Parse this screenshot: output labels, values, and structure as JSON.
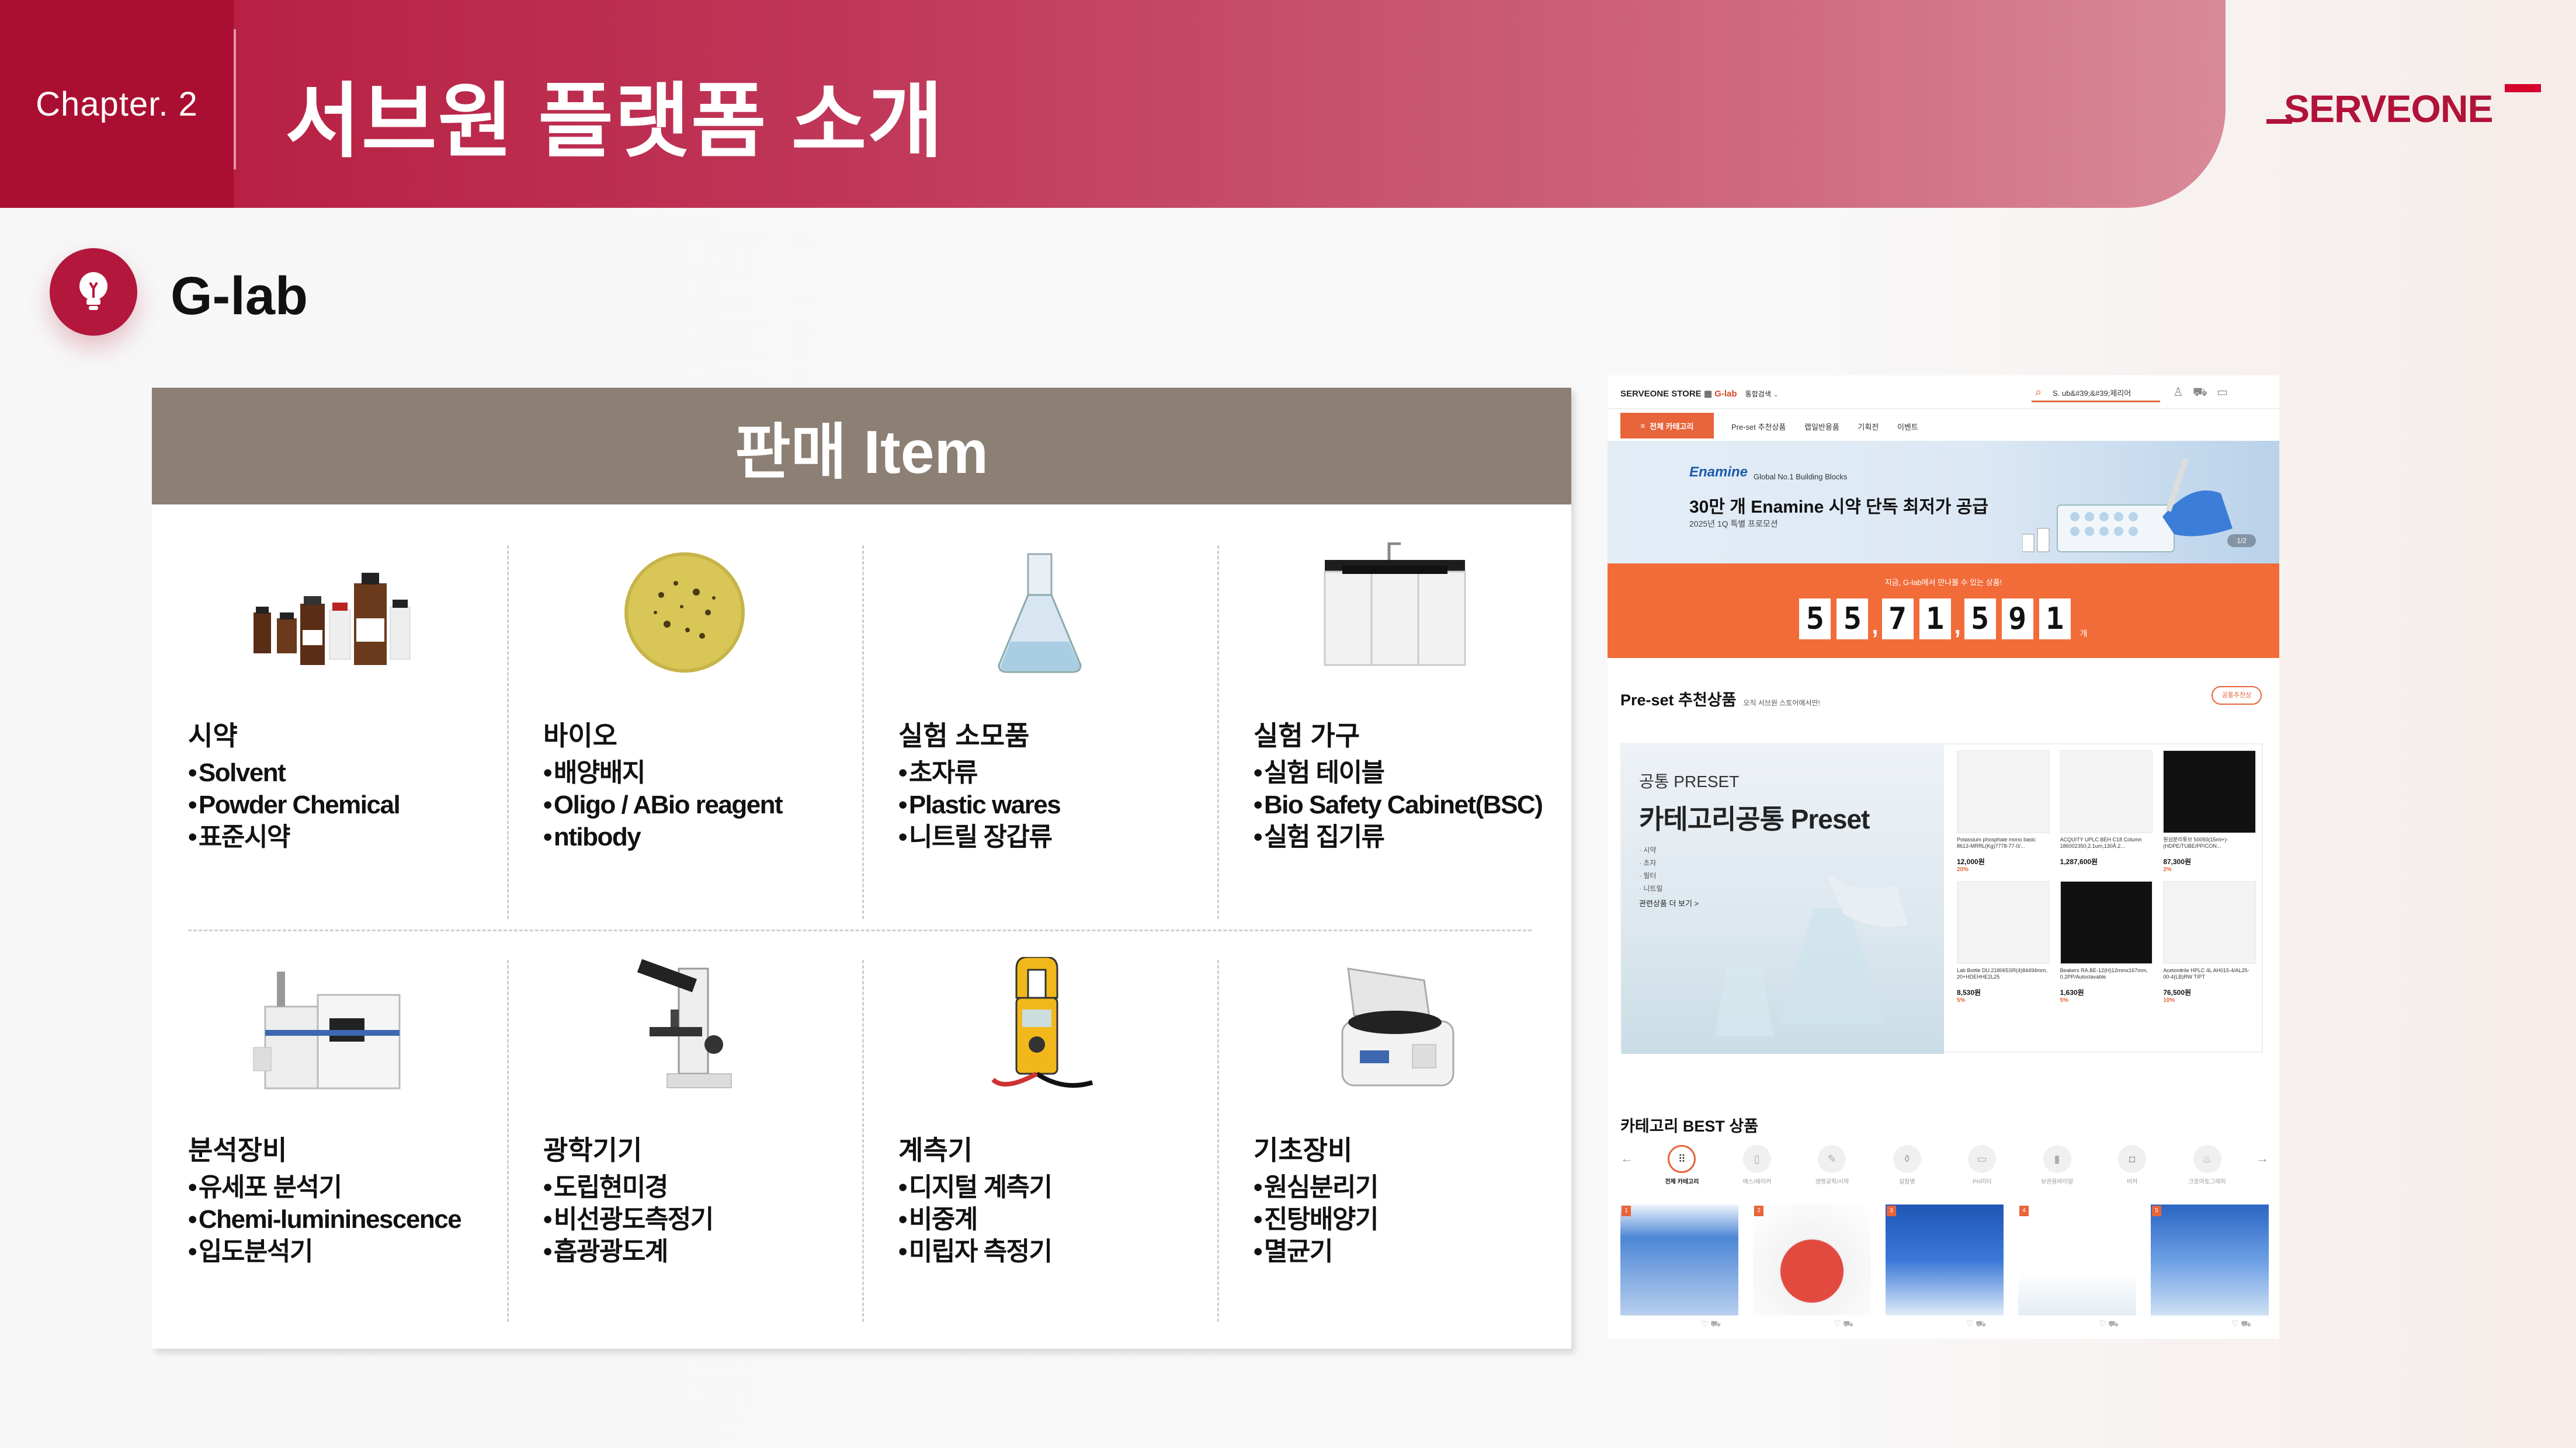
{
  "header": {
    "chapter": "Chapter. 2",
    "title": "서브원 플랫폼 소개",
    "logo": "SERVEONE"
  },
  "section": {
    "title": "G-lab"
  },
  "card": {
    "title": "판매 Item",
    "categories": [
      {
        "title": "시약",
        "items": [
          "Solvent",
          "Powder Chemical",
          "표준시약"
        ]
      },
      {
        "title": "바이오",
        "items": [
          "배양배지",
          "Oligo / ABio reagent",
          "ntibody"
        ]
      },
      {
        "title": "실험 소모품",
        "items": [
          "초자류",
          "Plastic wares",
          "니트릴 장갑류"
        ]
      },
      {
        "title": "실험 가구",
        "items": [
          "실험 테이블",
          "Bio Safety Cabinet(BSC)",
          "실험 집기류"
        ]
      },
      {
        "title": "분석장비",
        "items": [
          "유세포 분석기",
          "Chemi-lumininescence",
          "입도분석기"
        ]
      },
      {
        "title": "광학기기",
        "items": [
          "도립현미경",
          "비선광도측정기",
          "흡광광도계"
        ]
      },
      {
        "title": "계측기",
        "items": [
          "디지털 계측기",
          "비중계",
          "미립자 측정기"
        ]
      },
      {
        "title": "기초장비",
        "items": [
          "원심분리기",
          "진탕배양기",
          "멸균기"
        ]
      }
    ]
  },
  "shot": {
    "store": "SERVEONE STORE",
    "glab": "G-lab",
    "search": "통합검색",
    "search_query": "S. ub&#39;&#39;제리어",
    "all_category": "전체 카테고리",
    "menu": [
      "Pre-set 추천상품",
      "랩일반용품",
      "기획전",
      "이벤트"
    ],
    "hero": {
      "brand": "Enamine",
      "brand_sub": "Global No.1 Building Blocks",
      "title": "30만 개 Enamine 시약 단독 최저가 공급",
      "subtitle": "2025년 1Q 특별 프로모션",
      "page": "1/2"
    },
    "counter": {
      "caption": "지금, G-lab에서 만나볼 수 있는 상품!",
      "digits": [
        "5",
        "5",
        "7",
        "1",
        "5",
        "9",
        "1"
      ],
      "unit": "개"
    },
    "preset": {
      "heading": "Pre-set 추천상품",
      "heading_sub": "오직 서브원 스토어에서만!",
      "more": "공통추천상",
      "tag": "공통 PRESET",
      "name": "카테고리공통 Preset",
      "lines": [
        "· 시약",
        "· 초자",
        "· 필터",
        "· 니트릴"
      ],
      "link": "관련상품 더 보기 >",
      "products": [
        {
          "name": "Potassium phosphate mono basic 8613-MRRL(Kg)7778-77-0/...",
          "price": "12,000원",
          "disc": "20%"
        },
        {
          "name": "ACQUITY UPLC BEH C18 Column 186002350,2.1um,130Å,2...",
          "price": "1,287,600원",
          "disc": ""
        },
        {
          "name": "원심분리튜브 50050(15ml+)-(HDPE/TUBE/PP/CON...",
          "price": "87,300원",
          "disc": "2%"
        },
        {
          "name": "Lab Bottle DU.218065SR(4)84494mm, 20+HDEHHE2L25",
          "price": "8,530원",
          "disc": "5%"
        },
        {
          "name": "Beakers RA.BE-12(H)12mmx167mm, 0.2PP/Autoclavable",
          "price": "1,630원",
          "disc": "5%"
        },
        {
          "name": "Acetonitrile HPLC 4L AH015-4/AL25-00-4(LB)RW T/PT",
          "price": "76,500원",
          "disc": "10%"
        }
      ]
    },
    "best": {
      "heading": "카테고리 BEST 상품",
      "categories": [
        "전체 카테고리",
        "배스/쉐이커",
        "생명공학/시약",
        "실험병",
        "PH미터",
        "보관용바이알",
        "비커",
        "크로마토그래피"
      ],
      "ranks": [
        "1",
        "2",
        "3",
        "4",
        "5"
      ]
    }
  }
}
